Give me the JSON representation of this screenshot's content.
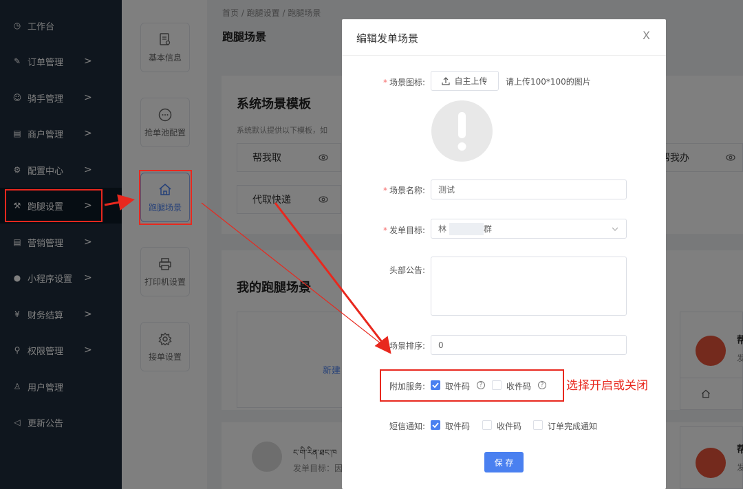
{
  "sidebar": {
    "items": [
      {
        "icon": "dashboard-icon",
        "label": "工作台",
        "chevron": ""
      },
      {
        "icon": "edit-icon",
        "label": "订单管理",
        "chevron": ">"
      },
      {
        "icon": "rider-icon",
        "label": "骑手管理",
        "chevron": ">"
      },
      {
        "icon": "store-icon",
        "label": "商户管理",
        "chevron": ">"
      },
      {
        "icon": "gear-icon",
        "label": "配置中心",
        "chevron": ">"
      },
      {
        "icon": "wrench-icon",
        "label": "跑腿设置",
        "chevron": ">"
      },
      {
        "icon": "marketing-icon",
        "label": "营销管理",
        "chevron": ">"
      },
      {
        "icon": "wechat-icon",
        "label": "小程序设置",
        "chevron": ">"
      },
      {
        "icon": "yen-icon",
        "label": "财务结算",
        "chevron": ">"
      },
      {
        "icon": "key-icon",
        "label": "权限管理",
        "chevron": ">"
      },
      {
        "icon": "user-icon",
        "label": "用户管理",
        "chevron": ""
      },
      {
        "icon": "announce-icon",
        "label": "更新公告",
        "chevron": ""
      }
    ]
  },
  "subnav": {
    "items": [
      {
        "icon": "document-user-icon",
        "label": "基本信息"
      },
      {
        "icon": "chat-icon",
        "label": "抢单池配置"
      },
      {
        "icon": "home-icon",
        "label": "跑腿场景"
      },
      {
        "icon": "printer-icon",
        "label": "打印机设置"
      },
      {
        "icon": "gear-icon",
        "label": "接单设置"
      }
    ]
  },
  "main": {
    "breadcrumb": "首页  /  跑腿设置  /  跑腿场景",
    "title": "跑腿场景",
    "templates_title": "系统场景模板",
    "templates_desc": "系统默认提供以下模板，如",
    "templates": [
      "帮我取",
      "代取快递",
      "帮我办"
    ],
    "my_title": "我的跑腿场景",
    "new_label": "新建",
    "card_partial": "帮",
    "card_sub": "发",
    "row_name": "ང་གི་རིན་ཐང་ཁ",
    "row_target": "发单目标：因"
  },
  "modal": {
    "title": "编辑发单场景",
    "close": "X",
    "icon_label": "场景图标:",
    "upload_label": "自主上传",
    "upload_hint": "请上传100*100的图片",
    "name_label": "场景名称:",
    "name_value": "测试",
    "target_label": "发单目标:",
    "target_value": "林",
    "target_value_end": "群",
    "notice_label": "头部公告:",
    "sort_label": "场景排序:",
    "sort_value": "0",
    "extra_label": "附加服务:",
    "extra_options": [
      {
        "label": "取件码",
        "checked": true
      },
      {
        "label": "收件码",
        "checked": false
      }
    ],
    "sms_label": "短信通知:",
    "sms_options": [
      {
        "label": "取件码",
        "checked": true
      },
      {
        "label": "收件码",
        "checked": false
      },
      {
        "label": "订单完成通知",
        "checked": false
      }
    ],
    "save_label": "保 存"
  },
  "annotation": {
    "note": "选择开启或关闭"
  },
  "colors": {
    "sidebar": "#1f2d3d",
    "accent": "#4a80f0",
    "annotation": "#e8281e"
  }
}
